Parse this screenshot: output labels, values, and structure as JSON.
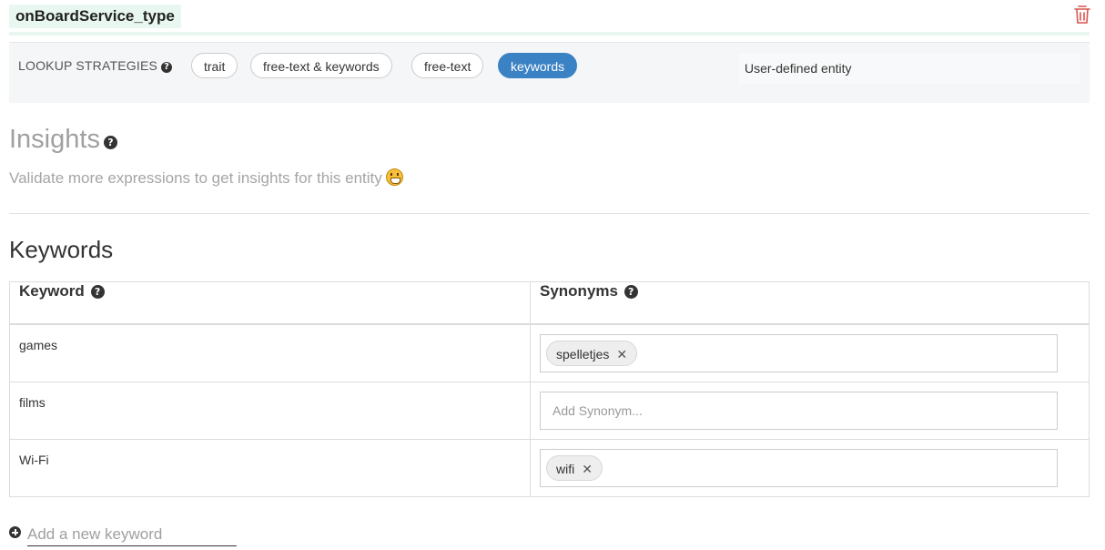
{
  "entity": {
    "name": "onBoardService_type",
    "delete_icon": "trash-icon",
    "delete_icon_color": "#d9534f"
  },
  "lookup": {
    "label": "LOOKUP STRATEGIES",
    "help_icon": "question-circle-icon",
    "strategies": [
      {
        "label": "trait",
        "active": false
      },
      {
        "label": "free-text & keywords",
        "active": false
      },
      {
        "label": "free-text",
        "active": false
      },
      {
        "label": "keywords",
        "active": true
      }
    ],
    "active_color": "#3b82c4",
    "entity_type": "User-defined entity"
  },
  "insights": {
    "title": "Insights",
    "subtitle": "Validate more expressions to get insights for this entity",
    "emoji_icon": "grinning-face-icon"
  },
  "keywords": {
    "title": "Keywords",
    "columns": {
      "keyword": "Keyword",
      "synonyms": "Synonyms"
    },
    "rows": [
      {
        "keyword": "games",
        "synonyms": [
          "spelletjes"
        ]
      },
      {
        "keyword": "films",
        "synonyms": [],
        "placeholder": "Add Synonym..."
      },
      {
        "keyword": "Wi-Fi",
        "synonyms": [
          "wifi"
        ]
      }
    ],
    "add_placeholder": "Add a new keyword"
  }
}
